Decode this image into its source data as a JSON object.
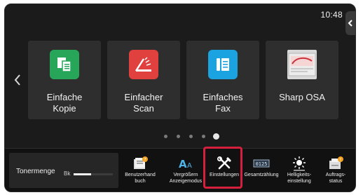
{
  "status": {
    "time": "10:48"
  },
  "side_tab": {
    "icon": "chevron-left-icon"
  },
  "nav": {
    "prev_icon": "chevron-left-icon"
  },
  "tiles": [
    {
      "line1": "Einfache",
      "line2": "Kopie",
      "icon": "copy-icon",
      "color": "#27a65a"
    },
    {
      "line1": "Einfacher",
      "line2": "Scan",
      "icon": "scan-icon",
      "color": "#e0413e"
    },
    {
      "line1": "Einfaches",
      "line2": "Fax",
      "icon": "fax-icon",
      "color": "#1aa3e0"
    },
    {
      "line1": "Sharp OSA",
      "line2": "",
      "icon": "sharp-osa-icon",
      "color": "#d9d9d9"
    }
  ],
  "pager": {
    "count": 5,
    "active_index": 4
  },
  "toner": {
    "label": "Tonermenge",
    "color_name": "Bk",
    "level_percent": 45
  },
  "quick": [
    {
      "line1": "Benutzerhand",
      "line2": "buch",
      "icon": "manual-icon"
    },
    {
      "line1": "Vergrößern",
      "line2": "Anzeigemodus",
      "icon": "text-enlarge-icon"
    },
    {
      "line1": "Einstellungen",
      "line2": "",
      "icon": "settings-tools-icon",
      "highlighted": true
    },
    {
      "line1": "Gesamtzählung",
      "line2": "",
      "icon": "counter-icon"
    },
    {
      "line1": "Helligkeits-",
      "line2": "einstellung",
      "icon": "brightness-icon"
    },
    {
      "line1": "Auftrags-",
      "line2": "status",
      "icon": "job-status-icon"
    }
  ],
  "colors": {
    "highlight": "#d61f3c",
    "screen_bg": "#1b1b1b",
    "tile_bg": "#2e2e2e"
  }
}
